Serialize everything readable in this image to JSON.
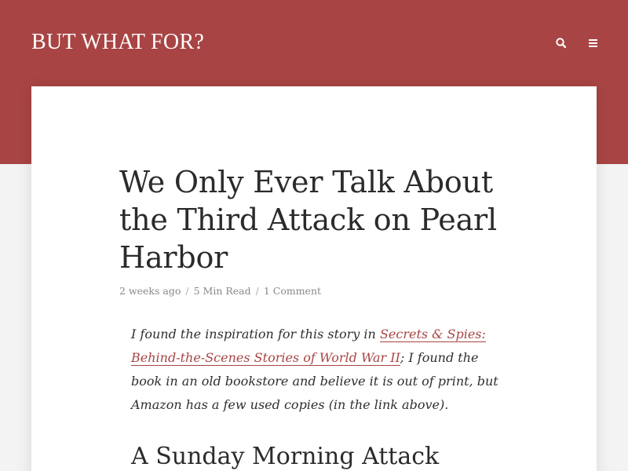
{
  "site": {
    "title": "BUT WHAT FOR?",
    "brand_color": "#a84444",
    "search_icon": "search-icon",
    "menu_icon": "hamburger-menu-icon"
  },
  "post": {
    "title": "We Only Ever Talk About the Third Attack on Pearl Harbor",
    "meta": {
      "date": "2 weeks ago",
      "separator": "/",
      "read_time": "5 Min Read",
      "comments": "1 Comment"
    },
    "intro": {
      "before_link": "I found the inspiration for this story in ",
      "link_text": "Secrets & Spies: Behind-the-Scenes Stories of World War II",
      "after_link": "; I found the book in an old bookstore and believe it is out of print, but Amazon has a few used copies (in the link above)."
    },
    "section_heading": "A Sunday Morning Attack"
  }
}
